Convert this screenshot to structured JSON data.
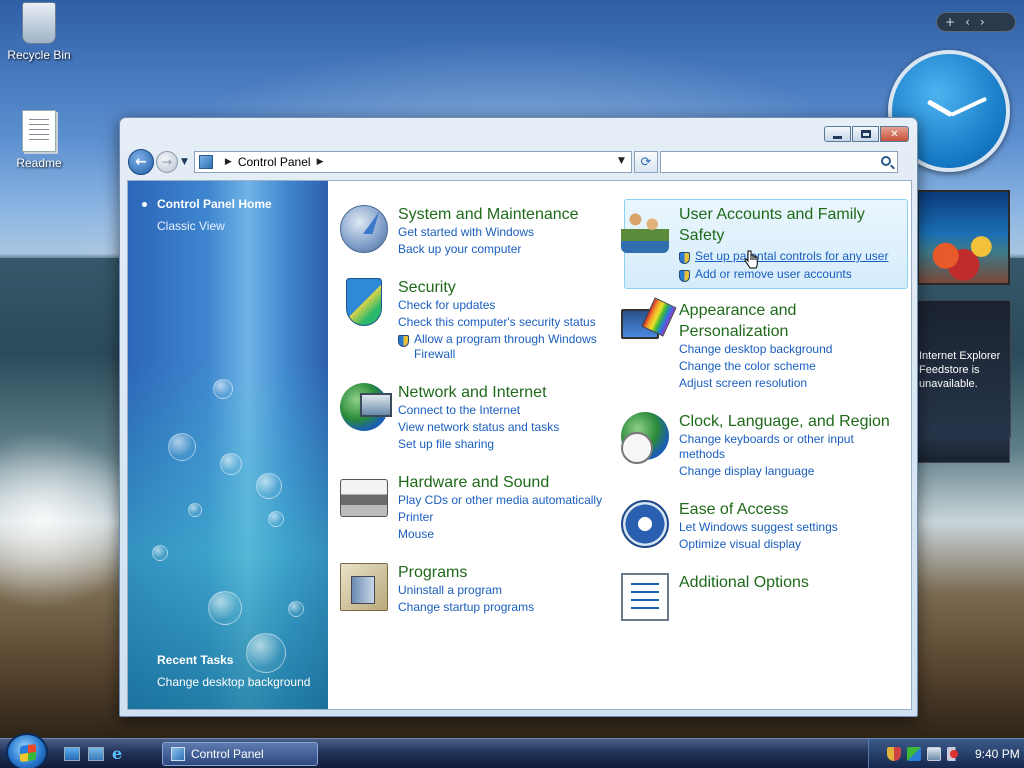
{
  "desktop": {
    "icons": [
      {
        "label": "Recycle Bin"
      },
      {
        "label": "Readme"
      }
    ],
    "feed_gadget_text": "Internet Explorer Feedstore is unavailable."
  },
  "window": {
    "address": {
      "crumb": "Control Panel"
    },
    "search": {
      "value": ""
    },
    "left_pane": {
      "home": "Control Panel Home",
      "classic": "Classic View",
      "recent_heading": "Recent Tasks",
      "recent_item": "Change desktop background"
    },
    "categories": [
      {
        "icon": "system-icon",
        "title": "System and Maintenance",
        "links": [
          "Get started with Windows",
          "Back up your computer"
        ]
      },
      {
        "icon": "security-icon",
        "title": "Security",
        "links": [
          "Check for updates",
          "Check this computer's security status"
        ],
        "shield_link": [
          "Allow a program through Windows",
          "Firewall"
        ]
      },
      {
        "icon": "network-icon",
        "title": "Network and Internet",
        "links": [
          "Connect to the Internet",
          "View network status and tasks",
          "Set up file sharing"
        ]
      },
      {
        "icon": "hardware-icon",
        "title": "Hardware and Sound",
        "links": [
          "Play CDs or other media automatically",
          "Printer",
          "Mouse"
        ]
      },
      {
        "icon": "programs-icon",
        "title": "Programs",
        "links": [
          "Uninstall a program",
          "Change startup programs"
        ]
      },
      {
        "icon": "users-icon",
        "title": [
          "User Accounts and Family",
          "Safety"
        ],
        "shield_links": [
          "Set up parental controls for any user",
          "Add or remove user accounts"
        ]
      },
      {
        "icon": "appearance-icon",
        "title": [
          "Appearance and",
          "Personalization"
        ],
        "links": [
          "Change desktop background",
          "Change the color scheme",
          "Adjust screen resolution"
        ]
      },
      {
        "icon": "clock-language-icon",
        "title": "Clock, Language, and Region",
        "links": [
          "Change keyboards or other input",
          "methods",
          "Change display language"
        ]
      },
      {
        "icon": "ease-of-access-icon",
        "title": "Ease of Access",
        "links": [
          "Let Windows suggest settings",
          "Optimize visual display"
        ]
      },
      {
        "icon": "additional-options-icon",
        "title": "Additional Options",
        "links": []
      }
    ]
  },
  "taskbar": {
    "task_button": "Control Panel",
    "clock": "9:40 PM"
  },
  "colors": {
    "category_title": "#1f6a1a",
    "link": "#1a5fbf",
    "left_pane": "#3f86cf"
  }
}
